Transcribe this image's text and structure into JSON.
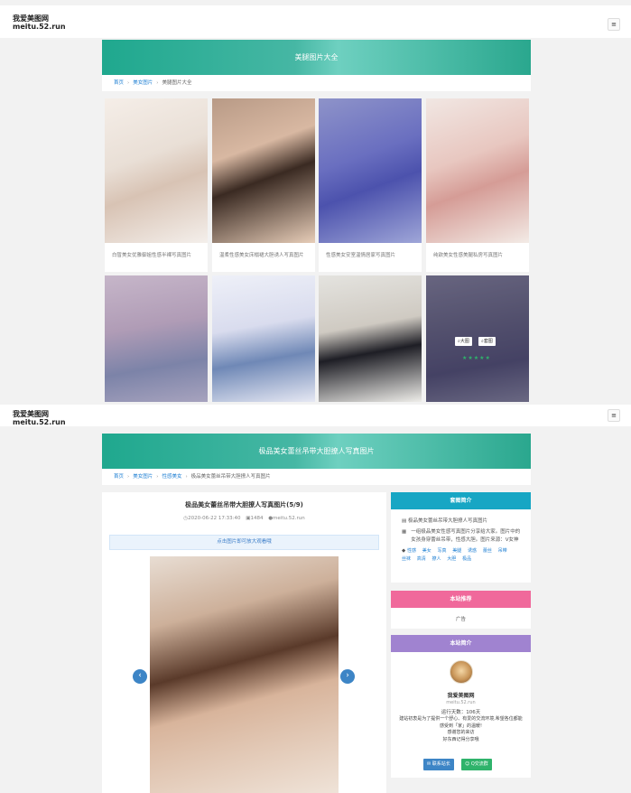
{
  "site": {
    "name": "我爱美图网",
    "domain": "meitu.52.run",
    "menu_icon": "menu-icon"
  },
  "list_page": {
    "hero_title": "美腿图片大全",
    "breadcrumb": [
      "首页",
      "美女图片",
      "美腿图片大全"
    ],
    "items": [
      {
        "caption": "白皙美女优雅御姐性感半裸写真图片"
      },
      {
        "caption": "温柔性感美女床榻裙大胆诱人写真图片"
      },
      {
        "caption": "性感美女安室温情居家写真图片"
      },
      {
        "caption": "纯欲美女性感美腿私房写真图片"
      },
      {
        "caption": ""
      },
      {
        "caption": ""
      },
      {
        "caption": ""
      },
      {
        "caption": ""
      }
    ],
    "overlay": {
      "big_label": "大图",
      "gallery_label": "套图",
      "rating": 5,
      "stars_text": "★★★★★"
    }
  },
  "detail_page": {
    "hero_title": "极品美女蕾丝吊带大胆撩人写真图片",
    "breadcrumb": [
      "首页",
      "美女图片",
      "性感美女",
      "极品美女蕾丝吊带大胆撩人写真图片"
    ],
    "article_title": "极品美女蕾丝吊带大胆撩人写真图片(5/9)",
    "meta": {
      "date": "2020-06-22 17:33:40",
      "views": "1484",
      "author": "meitu.52.run"
    },
    "tip": "点击图片即可放大观看哦",
    "prev_icon": "chevron-left-icon",
    "next_icon": "chevron-right-icon"
  },
  "sidebar": {
    "intro": {
      "header": "套图简介",
      "title": "极品美女蕾丝吊带大胆撩人写真图片",
      "desc": "一组极品美女性感写真图片分享给大家。图片中的女孩身穿蕾丝吊带，性感大胆。图片来源：V女神",
      "tags": [
        "性感",
        "美女",
        "写真",
        "美腿",
        "诱惑",
        "蕾丝",
        "吊带",
        "丝袜",
        "高清",
        "撩人",
        "大胆",
        "极品"
      ]
    },
    "recommend": {
      "header": "本站推荐",
      "content": "广告"
    },
    "about": {
      "header": "本站简介",
      "name": "我爱美图网",
      "domain": "meitu.52.run",
      "uptime": "运行天数：106天",
      "line1": "建站初衷是为了提供一个舒心、有爱的交流环境,希望各位都能感受到「家」的温暖!",
      "line2": "感谢您的来访",
      "line3": "好东西记得分享哦",
      "btn_contact": "联系站长",
      "btn_group": "Q交流群"
    }
  },
  "colors": {
    "teal": "#27a98d",
    "cyan_header": "#17a6c4",
    "pink_header": "#f0699b",
    "purple_header": "#a083d0",
    "link": "#1e7fd3",
    "green_btn": "#2fb36b",
    "blue_btn": "#3d85c6"
  }
}
